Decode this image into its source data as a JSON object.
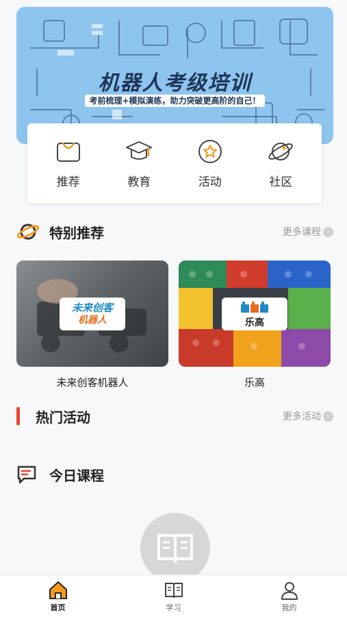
{
  "banner": {
    "title": "机器人考级培训",
    "subtitle": "考前梳理+模拟演练，助力突破更高阶的自己！"
  },
  "categories": [
    {
      "label": "推荐",
      "icon": "shopping-bag-icon"
    },
    {
      "label": "教育",
      "icon": "graduation-cap-icon"
    },
    {
      "label": "活动",
      "icon": "star-badge-icon"
    },
    {
      "label": "社区",
      "icon": "planet-icon"
    }
  ],
  "featured": {
    "title": "特别推荐",
    "more": "更多课程",
    "courses": [
      {
        "caption": "未来创客机器人",
        "logo_line1": "未来创客",
        "logo_line2": "机器人"
      },
      {
        "caption": "乐高",
        "logo_text": "乐高"
      }
    ]
  },
  "events": {
    "title": "热门活动",
    "more": "更多活动"
  },
  "today": {
    "title": "今日课程"
  },
  "nav": [
    {
      "label": "首页",
      "icon": "home-icon",
      "active": true
    },
    {
      "label": "学习",
      "icon": "book-icon",
      "active": false
    },
    {
      "label": "我的",
      "icon": "user-icon",
      "active": false
    }
  ],
  "colors": {
    "accent": "#f39a1e",
    "banner": "#8ec5ef",
    "red_bar": "#e8452c"
  }
}
